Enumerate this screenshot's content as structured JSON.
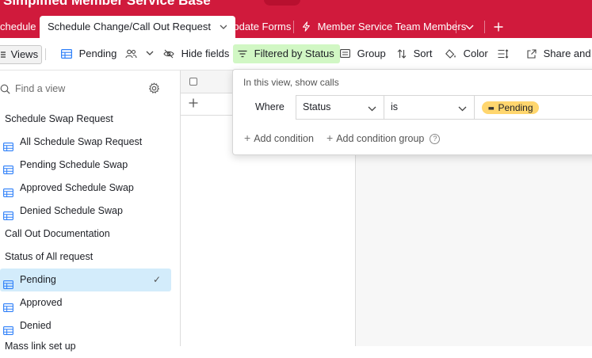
{
  "header": {
    "base_title": "Simplified Member Service Base",
    "tabs": [
      {
        "label": "chedule",
        "active": false
      },
      {
        "label": "Schedule Change/Call Out Request",
        "active": true
      },
      {
        "label": "Update Forms",
        "active": false
      },
      {
        "label": "Member Service Team Members",
        "active": false
      }
    ],
    "chevron": "⌄",
    "more_icon": "chevron-down-icon",
    "add_icon": "plus-icon",
    "brand_color": "#d01a3c"
  },
  "toolbar": {
    "views_label": "Views",
    "current_view": "Pending",
    "hide_fields": "Hide fields",
    "filtered_by": "Filtered by Status",
    "group": "Group",
    "sort": "Sort",
    "color": "Color",
    "share": "Share and sy",
    "filter_active_color": "#d1f7c4"
  },
  "sidebar": {
    "search_placeholder": "Find a view",
    "rows": [
      {
        "label": "Schedule Swap Request",
        "type": "section"
      },
      {
        "label": "All Schedule Swap Request",
        "type": "view"
      },
      {
        "label": "Pending Schedule Swap",
        "type": "view"
      },
      {
        "label": "Approved Schedule Swap",
        "type": "view"
      },
      {
        "label": "Denied Schedule Swap",
        "type": "view"
      },
      {
        "label": "Call Out Documentation",
        "type": "section"
      },
      {
        "label": "Status of All request",
        "type": "section"
      },
      {
        "label": "Pending",
        "type": "view",
        "selected": true
      },
      {
        "label": "Approved",
        "type": "view"
      },
      {
        "label": "Denied",
        "type": "view"
      },
      {
        "label": "Mass link set up",
        "type": "section"
      }
    ],
    "check": "✓",
    "selected_color": "#d3ecfb"
  },
  "filter_popover": {
    "title": "In this view, show calls",
    "where": "Where",
    "field": "Status",
    "operator": "is",
    "value": "Pending",
    "value_color": "#ffd66e",
    "add_condition": "Add condition",
    "add_condition_group": "Add condition group",
    "help": "?",
    "plus": "+"
  }
}
